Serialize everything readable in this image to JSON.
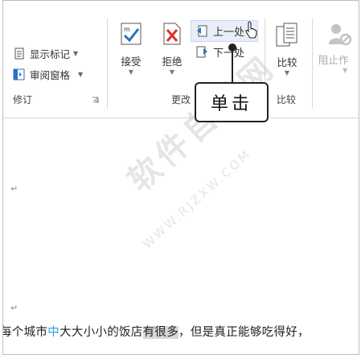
{
  "ribbon": {
    "show_markup": "显示标记",
    "reviewing_pane": "审阅窗格",
    "tracking_group": "修订",
    "accept": "接受",
    "reject": "拒绝",
    "previous": "上一处",
    "next": "下一处",
    "changes_group": "更改",
    "compare": "比较",
    "compare_group": "比较",
    "block_authors": "阻止作"
  },
  "callout": {
    "text": "单击"
  },
  "document": {
    "line_prefix": "每个城市",
    "line_blue": "中",
    "line_mid": "大大小小的饭店",
    "line_highlight": "有很多",
    "line_suffix": "，但是真正能够吃得好，"
  },
  "watermark": {
    "main": "软件自学网",
    "url": "WWW.RJZXW.COM"
  },
  "icons": {
    "show_markup": "document-lines-icon",
    "reviewing_pane": "pane-icon",
    "accept": "accept-check-icon",
    "reject": "reject-x-icon",
    "previous": "previous-change-icon",
    "next": "next-change-icon",
    "compare": "compare-documents-icon",
    "block_authors": "block-authors-icon",
    "cursor": "mouse-cursor-icon",
    "dialog_launcher": "dialog-launcher-icon"
  },
  "colors": {
    "accept_blue": "#2d6fc4",
    "reject_red": "#d9342b",
    "text_blue": "#2aa3de"
  }
}
